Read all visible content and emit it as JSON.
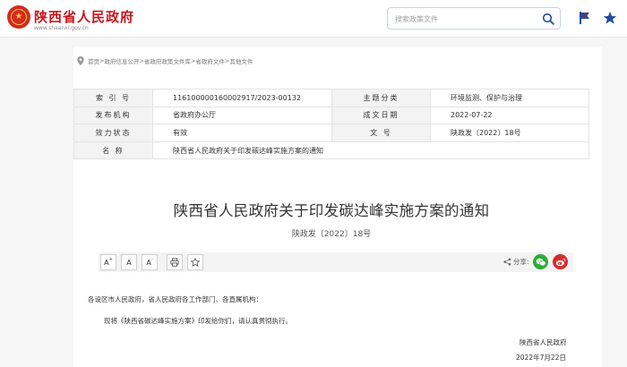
{
  "header": {
    "site_name": "陕西省人民政府",
    "site_url": "www.shaanxi.gov.cn",
    "search_placeholder": "搜索政策文件"
  },
  "breadcrumb": [
    "首页",
    "政府信息公开",
    "省政府政策文件库",
    "省政府文件",
    "其他文件"
  ],
  "breadcrumb_separator": ">",
  "meta": {
    "index_label": "索 引 号",
    "index_value": "116100000160002917/2023-00132",
    "topic_label": "主题分类",
    "topic_value": "环境监测、保护与治理",
    "issuer_label": "发布机构",
    "issuer_value": "省政府办公厅",
    "date_label": "成文日期",
    "date_value": "2022-07-22",
    "status_label": "效力状态",
    "status_value": "有效",
    "docno_label": "文 号",
    "docno_value": "陕政发〔2022〕18号",
    "name_label": "名 称",
    "name_value": "陕西省人民政府关于印发碳达峰实施方案的通知"
  },
  "document": {
    "title": "陕西省人民政府关于印发碳达峰实施方案的通知",
    "number": "陕政发〔2022〕18号",
    "para1": "各设区市人民政府，省人民政府各工作部门、各直属机构：",
    "para2": "现将《陕西省碳达峰实施方案》印发给你们，请认真贯彻执行。",
    "sign_org": "陕西省人民政府",
    "sign_date": "2022年7月22日"
  },
  "toolbar": {
    "font_increase": "A",
    "font_reset": "A",
    "font_decrease": "A",
    "plus": "+",
    "minus": "-",
    "share_label": "分享:"
  },
  "colors": {
    "brand_red": "#c8161d",
    "wechat_green": "#2aae39",
    "weibo_red": "#d82b2b",
    "accent_blue": "#1f4e9e"
  },
  "icons": [
    "national-emblem-icon",
    "search-icon",
    "flag-icon",
    "star-icon",
    "location-pin-icon",
    "print-icon",
    "bookmark-star-icon",
    "share-icon",
    "wechat-icon",
    "weibo-icon"
  ]
}
